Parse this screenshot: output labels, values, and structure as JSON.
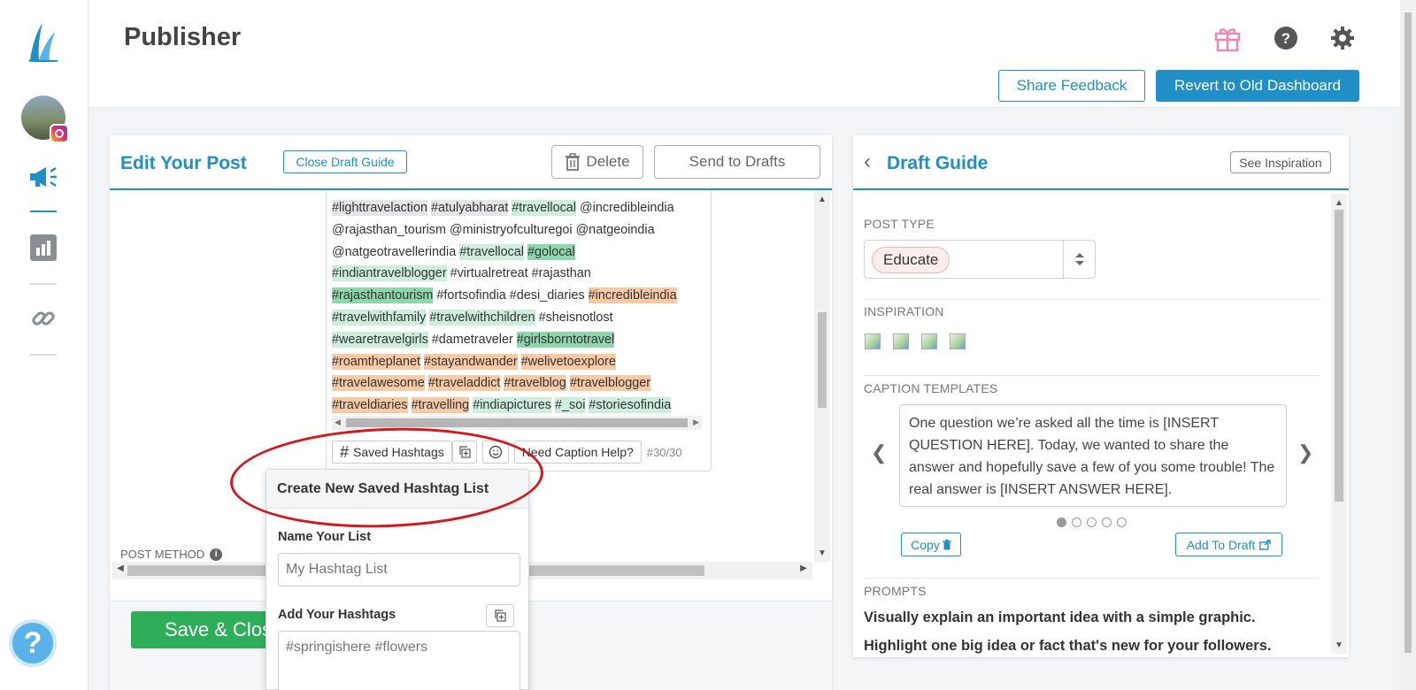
{
  "header": {
    "title": "Publisher",
    "share_feedback": "Share Feedback",
    "revert": "Revert to Old Dashboard"
  },
  "edit_panel": {
    "title": "Edit Your Post",
    "close_guide": "Close Draft Guide",
    "delete": "Delete",
    "send_to_drafts": "Send to Drafts",
    "caption_lines": [
      [
        [
          "#lighttravelaction",
          "g"
        ],
        [
          "#atulyabharat",
          "g"
        ],
        [
          "#travellocal",
          "l"
        ],
        [
          "@incredibleindia",
          ""
        ]
      ],
      [
        [
          "@rajasthan_tourism",
          ""
        ],
        [
          "@ministryofculturegoi",
          ""
        ],
        [
          "@natgeoindia",
          ""
        ]
      ],
      [
        [
          "@natgeotravellerindia",
          ""
        ],
        [
          "#travellocal",
          "l"
        ],
        [
          "#golocal",
          "d"
        ]
      ],
      [
        [
          "#indiantravelblogger",
          "l"
        ],
        [
          "#virtualretreat",
          ""
        ],
        [
          "#rajasthan",
          ""
        ]
      ],
      [
        [
          "#rajasthantourism",
          "d"
        ],
        [
          "#fortsofindia",
          ""
        ],
        [
          "#desi_diaries",
          ""
        ],
        [
          "#incredibleindia",
          "o"
        ]
      ],
      [
        [
          "#travelwithfamily",
          "l"
        ],
        [
          "#travelwithchildren",
          "l"
        ],
        [
          "#sheisnotlost",
          ""
        ]
      ],
      [
        [
          "#wearetravelgirls",
          "l"
        ],
        [
          "#dametraveler",
          ""
        ],
        [
          "#girlsborntotravel",
          "d"
        ]
      ],
      [
        [
          "#roamtheplanet",
          "o"
        ],
        [
          "#stayandwander",
          "o"
        ],
        [
          "#welivetoexplore",
          "o"
        ]
      ],
      [
        [
          "#travelawesome",
          "o"
        ],
        [
          "#traveladdict",
          "o"
        ],
        [
          "#travelblog",
          "o"
        ],
        [
          "#travelblogger",
          "o"
        ]
      ],
      [
        [
          "#traveldiaries",
          "o"
        ],
        [
          "#travelling",
          "o"
        ],
        [
          "#indiapictures",
          "l"
        ],
        [
          "#_soi",
          "l"
        ],
        [
          "#storiesofindia",
          "l"
        ]
      ]
    ],
    "saved_hashtags": "Saved Hashtags",
    "need_caption_help": "Need Caption Help?",
    "hashtag_count": "#30/30",
    "post_method": "POST METHOD",
    "save_close": "Save & Close"
  },
  "popup": {
    "title": "Create New Saved Hashtag List",
    "name_label": "Name Your List",
    "name_placeholder": "My Hashtag List",
    "hashtags_label": "Add Your Hashtags",
    "hashtags_placeholder": "#springishere #flowers"
  },
  "draft_guide": {
    "title": "Draft Guide",
    "see_inspiration": "See Inspiration",
    "post_type_label": "POST TYPE",
    "post_type_value": "Educate",
    "inspiration_label": "INSPIRATION",
    "caption_templates_label": "CAPTION TEMPLATES",
    "template_text": "One question we’re asked all the time is [INSERT QUESTION HERE]. Today, we wanted to share the answer and hopefully save a few of you some trouble! The real answer is [INSERT ANSWER HERE].",
    "copy": "Copy",
    "add_to_draft": "Add To Draft",
    "prompts_label": "PROMPTS",
    "prompts": [
      "Visually explain an important idea with a simple graphic.",
      "Highlight one big idea or fact that's new for your followers."
    ]
  },
  "colors": {
    "accent": "#1f8fc6",
    "save_green": "#2fae5a",
    "hashtag_light_green": "#cdeedd",
    "hashtag_dark_green": "#8ed7ad",
    "hashtag_orange": "#f7c9a4",
    "hashtag_gray": "#e3e5e7",
    "annotation_red": "#d5161b"
  }
}
